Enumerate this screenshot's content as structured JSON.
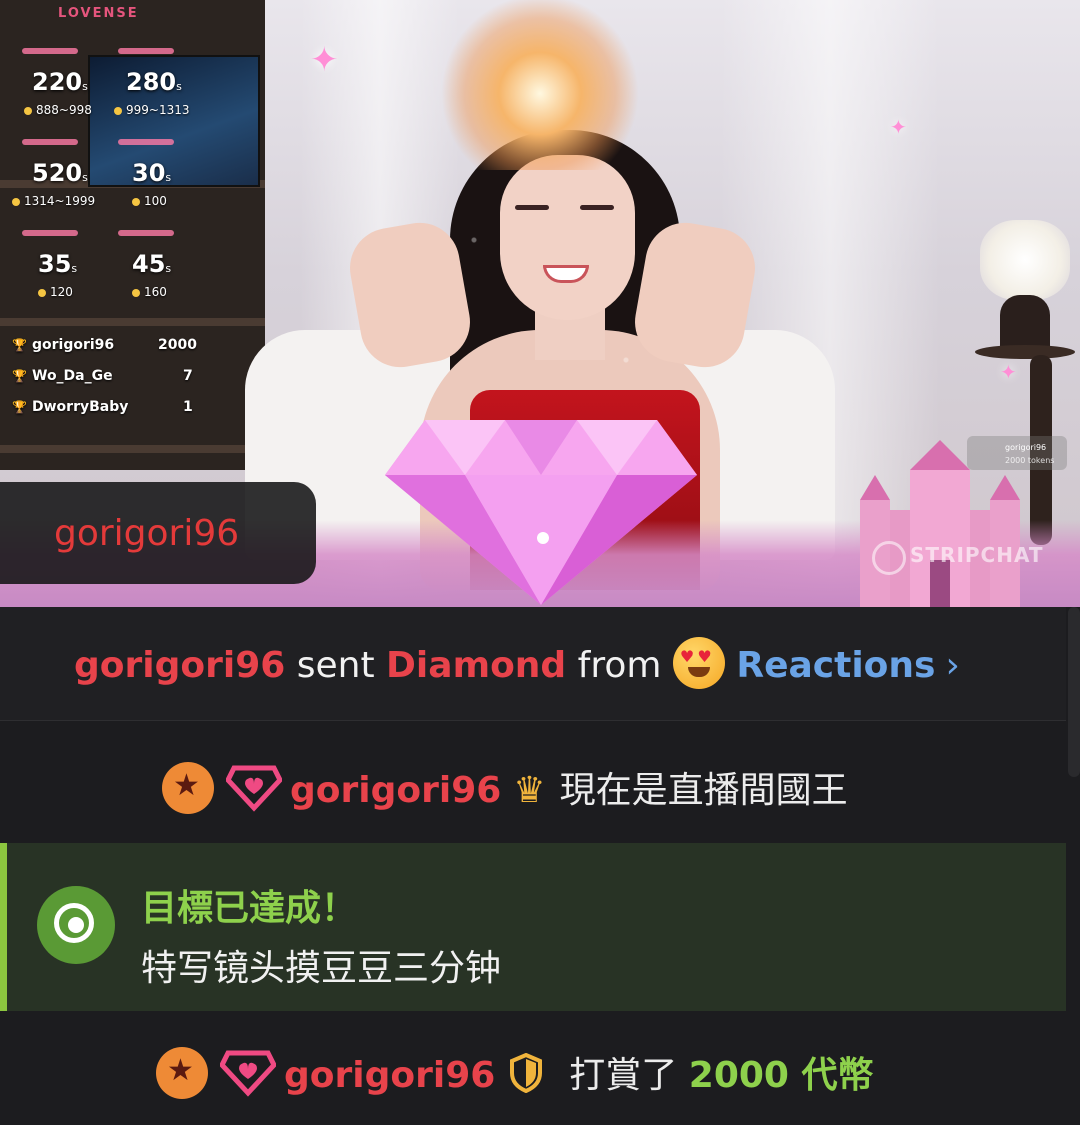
{
  "stream": {
    "brand_logo": "LOVENSE",
    "watermark": "STRIPCHAT",
    "tip_menu": [
      {
        "seconds": "220",
        "unit": "s",
        "range": "888~998"
      },
      {
        "seconds": "280",
        "unit": "s",
        "range": "999~1313"
      },
      {
        "seconds": "520",
        "unit": "s",
        "range": "1314~1999"
      },
      {
        "seconds": "30",
        "unit": "s",
        "range": "100"
      },
      {
        "seconds": "35",
        "unit": "s",
        "range": "120"
      },
      {
        "seconds": "45",
        "unit": "s",
        "range": "160"
      }
    ],
    "leaderboard": [
      {
        "name": "gorigori96",
        "amount": "2000"
      },
      {
        "name": "Wo_Da_Ge",
        "amount": "7"
      },
      {
        "name": "DworryBaby",
        "amount": "1"
      }
    ],
    "king_bubble_name": "gorigori96",
    "mini_tag": {
      "name": "gorigori96",
      "amount": "2000 tokens"
    }
  },
  "chat": {
    "gift_message": {
      "user": "gorigori96",
      "verb": "sent",
      "gift": "Diamond",
      "from": "from",
      "source": "Reactions",
      "source_chevron": "›"
    },
    "king_message": {
      "user": "gorigori96",
      "text": "現在是直播間國王"
    },
    "goal_message": {
      "title": "目標已達成！",
      "text": "特写镜头摸豆豆三分钟"
    },
    "tip_message": {
      "user": "gorigori96",
      "text": "打賞了",
      "amount": "2000 代幣"
    }
  },
  "colors": {
    "username_red": "#e8434b",
    "link_blue": "#6aa3e6",
    "goal_green": "#8ed14c",
    "chat_bg": "#1c1c1f"
  }
}
